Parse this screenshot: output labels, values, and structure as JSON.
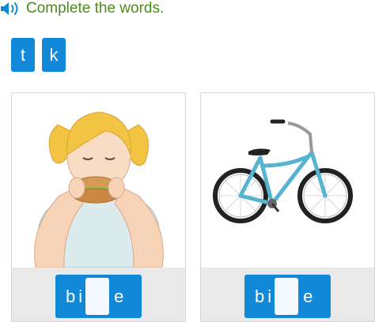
{
  "instruction": "Complete the words.",
  "tiles": [
    "t",
    "k"
  ],
  "cards": [
    {
      "picture": "girl-eating-sandwich",
      "letters_before": [
        "b",
        "i"
      ],
      "letter_after": "e",
      "slot_value": ""
    },
    {
      "picture": "bicycle",
      "letters_before": [
        "b",
        "i"
      ],
      "letter_after": "e",
      "slot_value": ""
    }
  ],
  "colors": {
    "tile_blue": "#1289d8",
    "instruction_green": "#4a8c1c",
    "slot_bg": "#f4f9fd",
    "footer_bg": "#e9e9e9"
  }
}
